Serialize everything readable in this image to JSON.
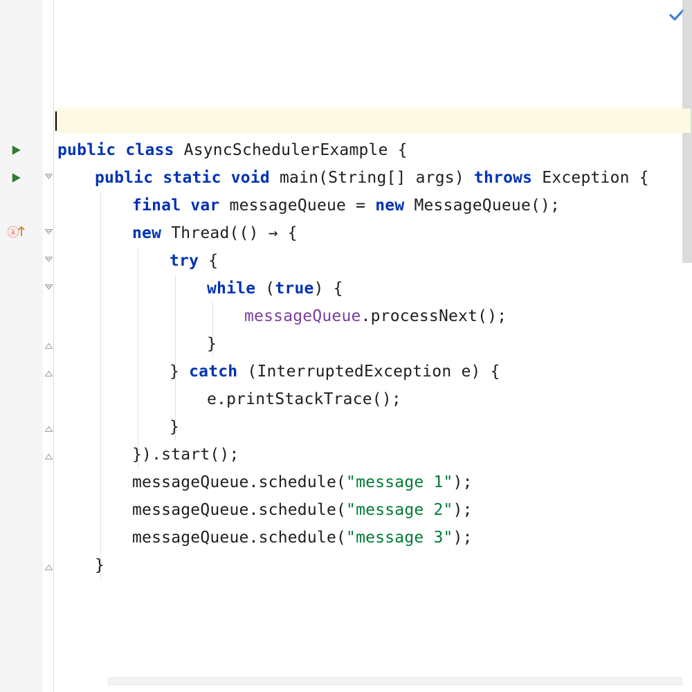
{
  "colors": {
    "keyword": "#0033b3",
    "string": "#007a33",
    "field": "#7a3e9d",
    "accent": "#3e7de0",
    "currentLine": "#fdfae3",
    "gutter": "#f5f5f5"
  },
  "lineHeight": 40,
  "topOffset": 157,
  "code": {
    "lines": [
      {
        "y": 0,
        "type": "current",
        "raw": ""
      },
      {
        "y": 1,
        "type": "code",
        "indent": 0,
        "tokens": [
          {
            "t": "public",
            "c": "kw"
          },
          {
            "t": " "
          },
          {
            "t": "class",
            "c": "kw"
          },
          {
            "t": " AsyncSchedulerExample {"
          }
        ]
      },
      {
        "y": 2,
        "type": "code",
        "indent": 1,
        "tokens": [
          {
            "t": "public",
            "c": "kw"
          },
          {
            "t": " "
          },
          {
            "t": "static",
            "c": "kw"
          },
          {
            "t": " "
          },
          {
            "t": "void",
            "c": "kw"
          },
          {
            "t": " main(String[] args) "
          },
          {
            "t": "throws",
            "c": "kw"
          },
          {
            "t": " Exception {"
          }
        ]
      },
      {
        "y": 3,
        "type": "code",
        "indent": 2,
        "tokens": [
          {
            "t": "final",
            "c": "kw"
          },
          {
            "t": " "
          },
          {
            "t": "var",
            "c": "kw"
          },
          {
            "t": " messageQueue = "
          },
          {
            "t": "new",
            "c": "kw"
          },
          {
            "t": " MessageQueue();"
          }
        ]
      },
      {
        "y": 4,
        "type": "code",
        "indent": 2,
        "tokens": [
          {
            "t": "new",
            "c": "kw"
          },
          {
            "t": " Thread(() "
          },
          {
            "t": "→",
            "c": "arrow"
          },
          {
            "t": " {"
          }
        ]
      },
      {
        "y": 5,
        "type": "code",
        "indent": 3,
        "tokens": [
          {
            "t": "try",
            "c": "kw"
          },
          {
            "t": " {"
          }
        ]
      },
      {
        "y": 6,
        "type": "code",
        "indent": 4,
        "tokens": [
          {
            "t": "while",
            "c": "kw"
          },
          {
            "t": " ("
          },
          {
            "t": "true",
            "c": "kw"
          },
          {
            "t": ") {"
          }
        ]
      },
      {
        "y": 7,
        "type": "code",
        "indent": 5,
        "tokens": [
          {
            "t": "messageQueue",
            "c": "fld"
          },
          {
            "t": ".processNext();"
          }
        ]
      },
      {
        "y": 8,
        "type": "code",
        "indent": 4,
        "tokens": [
          {
            "t": "}"
          }
        ]
      },
      {
        "y": 9,
        "type": "code",
        "indent": 3,
        "tokens": [
          {
            "t": "} "
          },
          {
            "t": "catch",
            "c": "kw"
          },
          {
            "t": " (InterruptedException e) {"
          }
        ]
      },
      {
        "y": 10,
        "type": "code",
        "indent": 4,
        "tokens": [
          {
            "t": "e.printStackTrace();"
          }
        ]
      },
      {
        "y": 11,
        "type": "code",
        "indent": 3,
        "tokens": [
          {
            "t": "}"
          }
        ]
      },
      {
        "y": 12,
        "type": "code",
        "indent": 2,
        "tokens": [
          {
            "t": "}).start();"
          }
        ]
      },
      {
        "y": 13,
        "type": "code",
        "indent": 2,
        "tokens": [
          {
            "t": "messageQueue.schedule("
          },
          {
            "t": "\"message 1\"",
            "c": "str"
          },
          {
            "t": ");"
          }
        ]
      },
      {
        "y": 14,
        "type": "code",
        "indent": 2,
        "tokens": [
          {
            "t": "messageQueue.schedule("
          },
          {
            "t": "\"message 2\"",
            "c": "str"
          },
          {
            "t": ");"
          }
        ]
      },
      {
        "y": 15,
        "type": "code",
        "indent": 2,
        "tokens": [
          {
            "t": "messageQueue.schedule("
          },
          {
            "t": "\"message 3\"",
            "c": "str"
          },
          {
            "t": ");"
          }
        ]
      },
      {
        "y": 16,
        "type": "code",
        "indent": 1,
        "tokens": [
          {
            "t": "}"
          }
        ]
      }
    ]
  },
  "gutter": {
    "runIcons": [
      1,
      2
    ],
    "lambdaIcon": 4,
    "foldMinus": [
      2,
      4,
      5,
      6
    ],
    "foldEnd": [
      8,
      9,
      11,
      12,
      16
    ]
  },
  "indentGuides": [
    {
      "col": 1,
      "from": 3,
      "to": 16
    },
    {
      "col": 2,
      "from": 5,
      "to": 12
    },
    {
      "col": 3,
      "from": 6,
      "to": 11
    },
    {
      "col": 4,
      "from": 7,
      "to": 8
    }
  ],
  "icons": {
    "check": "check-icon",
    "run": "run-icon",
    "lambda": "lambda-icon",
    "foldMinus": "fold-collapse-icon",
    "foldEnd": "fold-end-icon"
  }
}
